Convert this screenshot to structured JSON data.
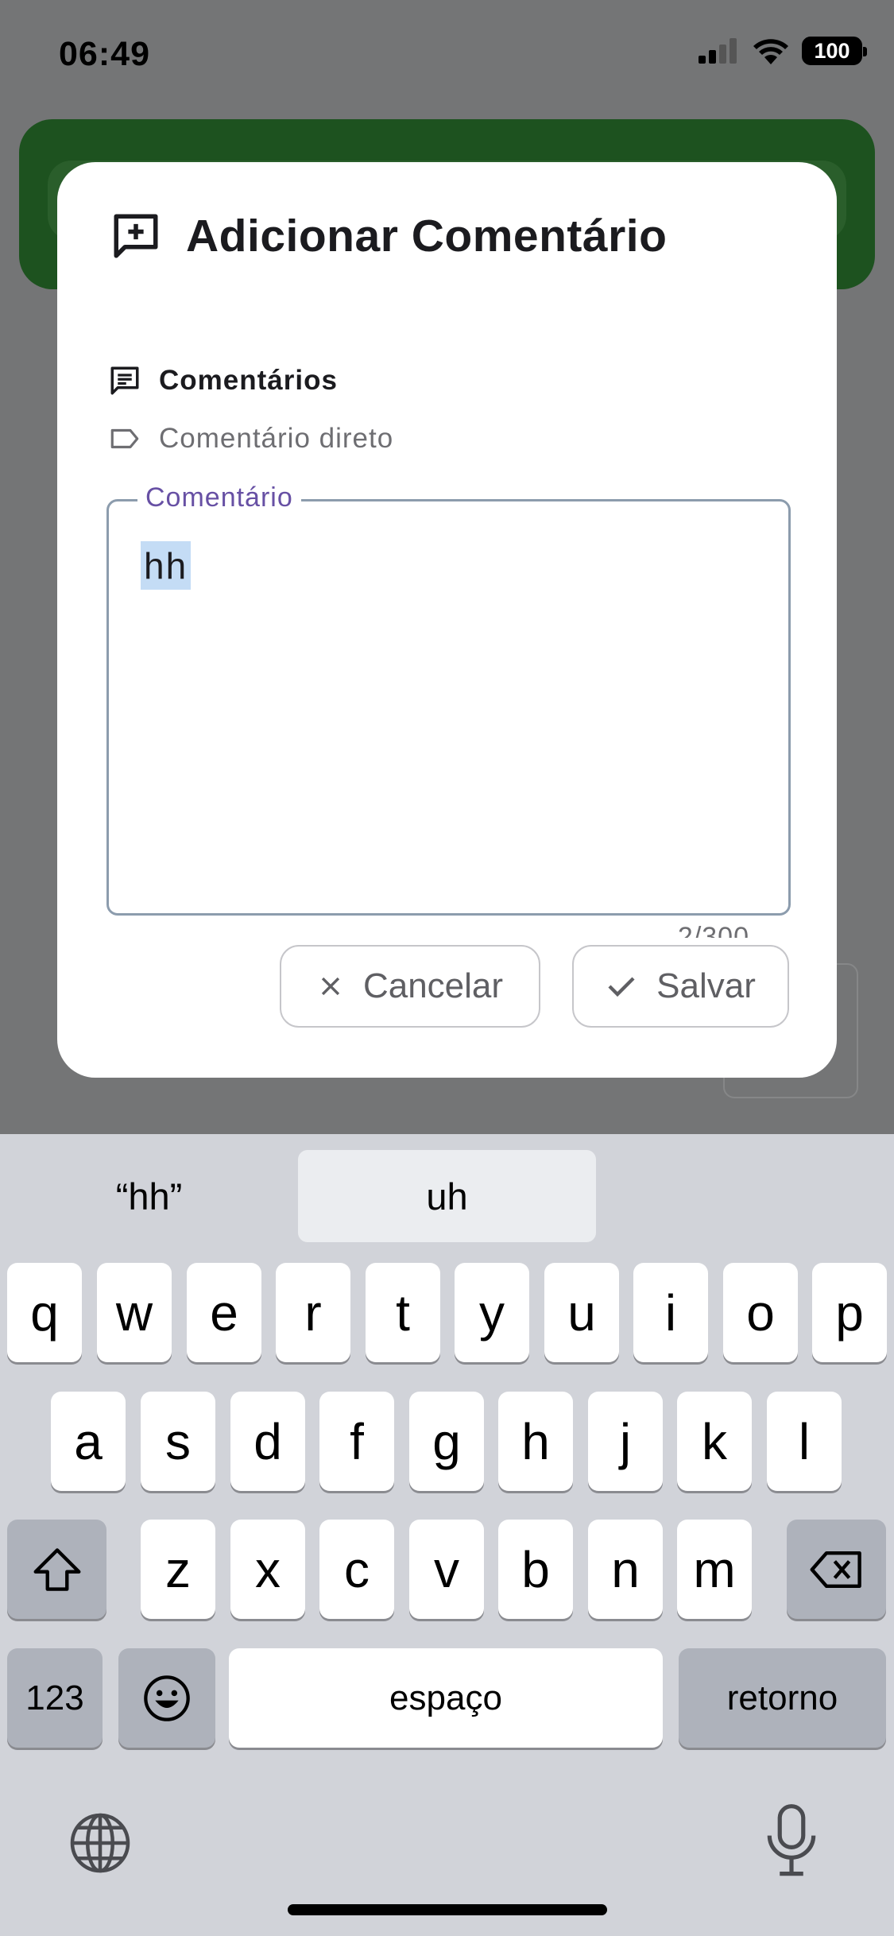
{
  "status_bar": {
    "time": "06:49",
    "battery": "100"
  },
  "dialog": {
    "title": "Adicionar Comentário",
    "section_label": "Comentários",
    "tag_label": "Comentário direto",
    "field": {
      "label": "Comentário",
      "value": "hh",
      "counter": "2/300"
    },
    "buttons": {
      "cancel": "Cancelar",
      "save": "Salvar"
    }
  },
  "keyboard": {
    "suggestions": [
      "“hh”",
      "uh",
      ""
    ],
    "rows": [
      [
        "q",
        "w",
        "e",
        "r",
        "t",
        "y",
        "u",
        "i",
        "o",
        "p"
      ],
      [
        "a",
        "s",
        "d",
        "f",
        "g",
        "h",
        "j",
        "k",
        "l"
      ],
      [
        "z",
        "x",
        "c",
        "v",
        "b",
        "n",
        "m"
      ]
    ],
    "numbers_key": "123",
    "space_key": "espaço",
    "return_key": "retorno"
  },
  "colors": {
    "accent": "#6750a4",
    "selection": "#c4dcf5",
    "header_green": "#1d521f"
  }
}
